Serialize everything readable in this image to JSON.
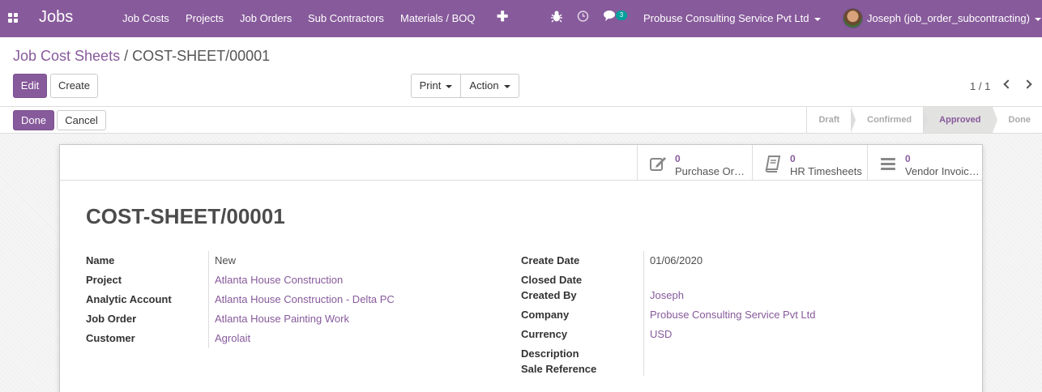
{
  "nav": {
    "app_title": "Jobs",
    "menu": [
      "Job Costs",
      "Projects",
      "Job Orders",
      "Sub Contractors",
      "Materials / BOQ"
    ],
    "plus": "✚",
    "chat_badge": "3",
    "company": "Probuse Consulting Service Pvt Ltd",
    "user": "Joseph (job_order_subcontracting)"
  },
  "breadcrumb": {
    "parent": "Job Cost Sheets",
    "separator": "/",
    "current": "COST-SHEET/00001"
  },
  "buttons": {
    "edit": "Edit",
    "create": "Create",
    "print": "Print",
    "action": "Action",
    "done": "Done",
    "cancel": "Cancel"
  },
  "pager": "1 / 1",
  "stages": [
    "Draft",
    "Confirmed",
    "Approved",
    "Done"
  ],
  "active_stage": "Approved",
  "smart_buttons": [
    {
      "count": "0",
      "label": "Purchase Orders",
      "icon": "pencil-square-icon"
    },
    {
      "count": "0",
      "label": "HR Timesheets",
      "icon": "book-icon"
    },
    {
      "count": "0",
      "label": "Vendor Invoices",
      "icon": "list-icon"
    }
  ],
  "record": {
    "title": "COST-SHEET/00001",
    "left": {
      "name_label": "Name",
      "name": "New",
      "project_label": "Project",
      "project": "Atlanta House Construction",
      "analytic_label": "Analytic Account",
      "analytic": "Atlanta House Construction - Delta PC",
      "job_order_label": "Job Order",
      "job_order": "Atlanta House Painting Work",
      "customer_label": "Customer",
      "customer": "Agrolait"
    },
    "right": {
      "create_date_label": "Create Date",
      "create_date": "01/06/2020",
      "closed_date_label": "Closed Date",
      "closed_date": "",
      "created_by_label": "Created By",
      "created_by": "Joseph",
      "company_label": "Company",
      "company": "Probuse Consulting Service Pvt Ltd",
      "currency_label": "Currency",
      "currency": "USD",
      "description_label": "Description",
      "description": "",
      "sale_ref_label": "Sale Reference",
      "sale_ref": ""
    }
  },
  "colors": {
    "brand": "#875a9b",
    "badge": "#00a09d"
  }
}
